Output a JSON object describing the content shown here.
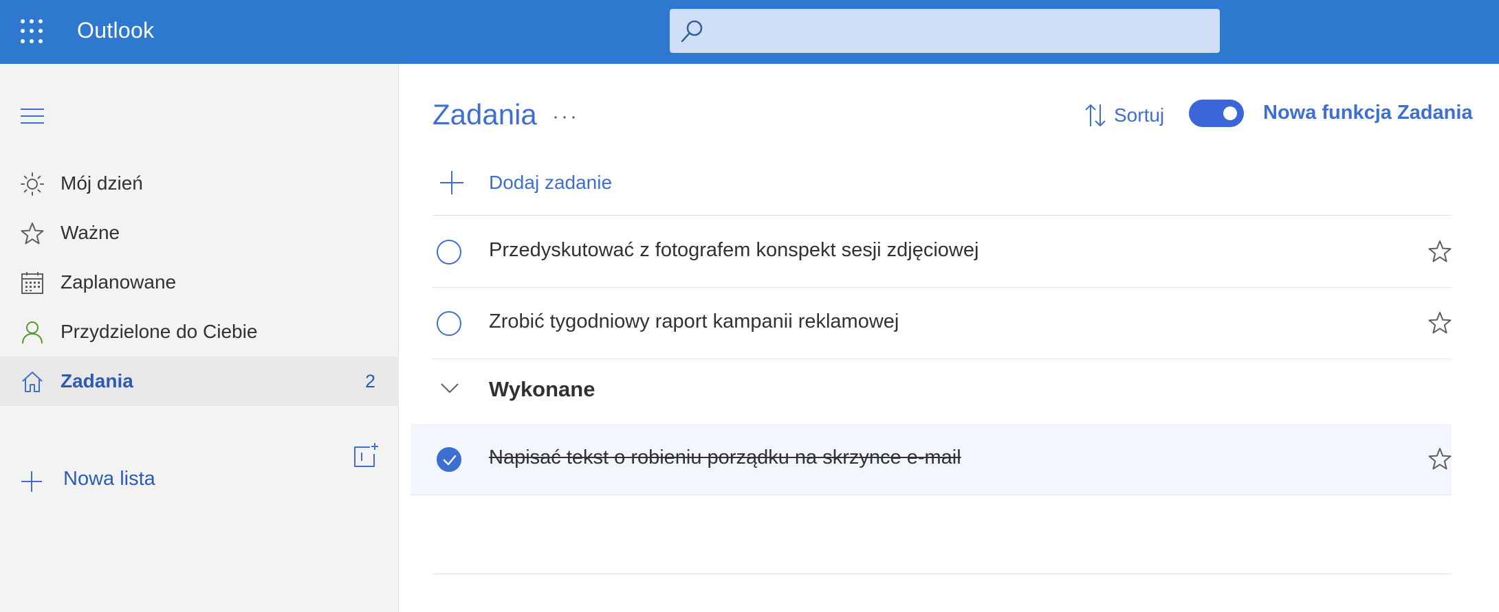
{
  "app": {
    "title": "Outlook"
  },
  "search": {
    "placeholder": ""
  },
  "sidebar": {
    "items": [
      {
        "label": "Mój dzień",
        "icon": "sun-icon"
      },
      {
        "label": "Ważne",
        "icon": "star-icon"
      },
      {
        "label": "Zaplanowane",
        "icon": "calendar-icon"
      },
      {
        "label": "Przydzielone do Ciebie",
        "icon": "person-icon"
      },
      {
        "label": "Zadania",
        "icon": "home-icon",
        "count": "2",
        "active": true
      }
    ],
    "new_list_label": "Nowa lista"
  },
  "main": {
    "title": "Zadania",
    "more_label": "···",
    "sort_label": "Sortuj",
    "toggle_on": true,
    "new_feature_label": "Nowa funkcja Zadania",
    "add_task_label": "Dodaj zadanie",
    "tasks": [
      {
        "label": "Przedyskutować z fotografem konspekt sesji zdjęciowej",
        "done": false
      },
      {
        "label": "Zrobić tygodniowy raport kampanii reklamowej",
        "done": false
      }
    ],
    "completed_section_label": "Wykonane",
    "completed_tasks": [
      {
        "label": "Napisać tekst o robieniu porządku na skrzynce e-mail",
        "done": true
      }
    ]
  },
  "colors": {
    "topbar": "#2f78d0",
    "accent": "#3c6fd1",
    "sidebar_bg": "#f3f3f3",
    "toggle": "#3b66d8"
  }
}
